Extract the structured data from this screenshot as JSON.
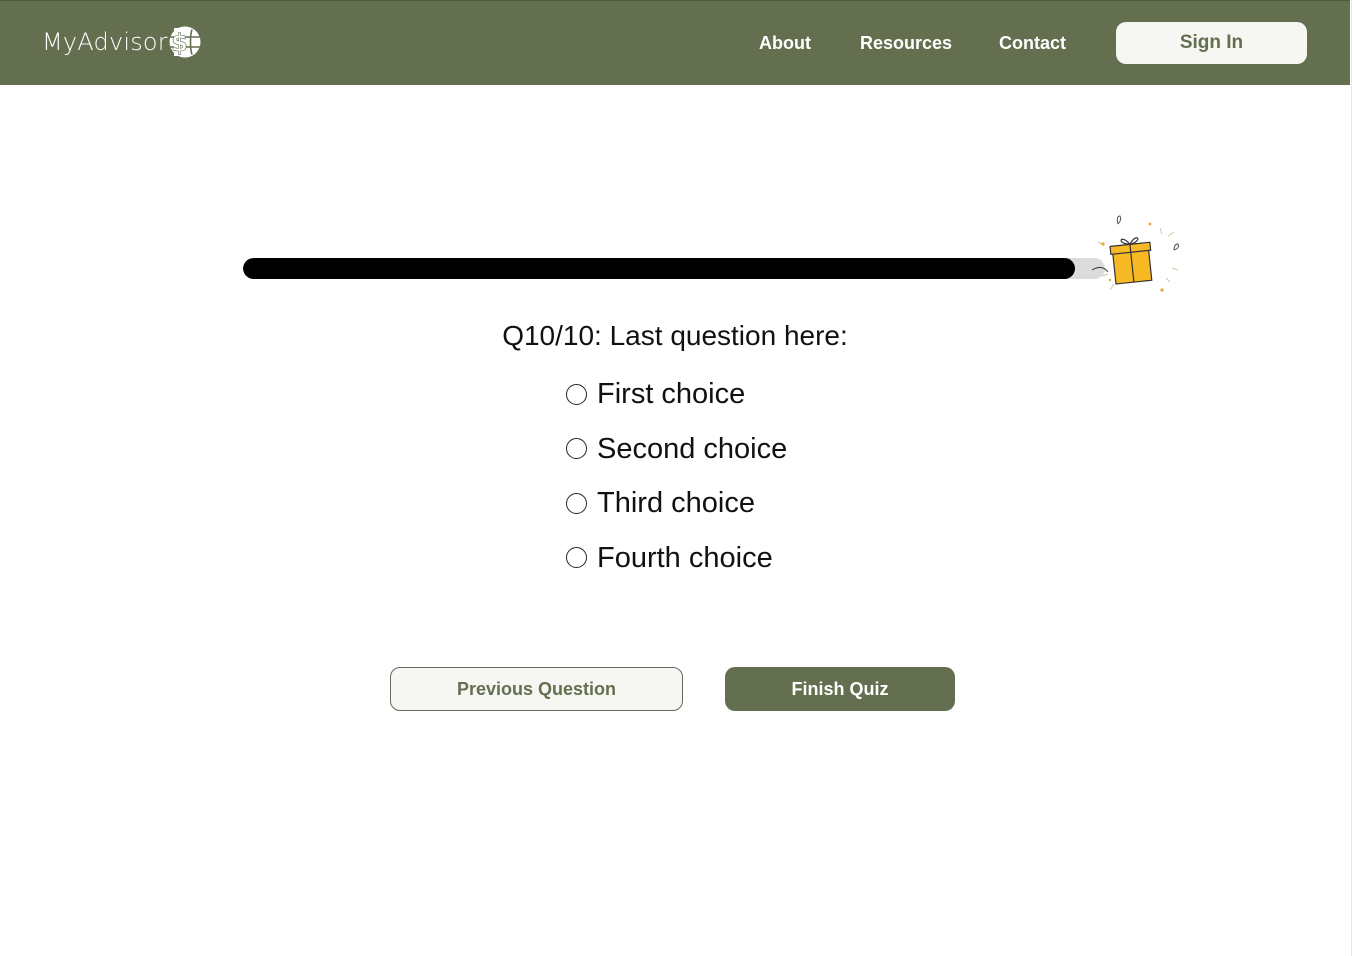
{
  "header": {
    "brand": "MyAdvisor",
    "brand_icon": "globe-dollar-icon",
    "nav": {
      "about": "About",
      "resources": "Resources",
      "contact": "Contact"
    },
    "sign_in_label": "Sign In"
  },
  "quiz": {
    "progress_fraction": 0.965,
    "progress_icon": "gift-icon",
    "question": "Q10/10: Last question here:",
    "choices": [
      {
        "label": "First choice",
        "selected": false
      },
      {
        "label": "Second choice",
        "selected": false
      },
      {
        "label": "Third choice",
        "selected": false
      },
      {
        "label": "Fourth choice",
        "selected": false
      }
    ],
    "previous_label": "Previous Question",
    "finish_label": "Finish Quiz"
  },
  "colors": {
    "brand": "#636f4e",
    "button_light": "#f6f6f3",
    "progress_fill": "#000000",
    "progress_track": "#dcdcdc",
    "gift": "#f7b924"
  }
}
